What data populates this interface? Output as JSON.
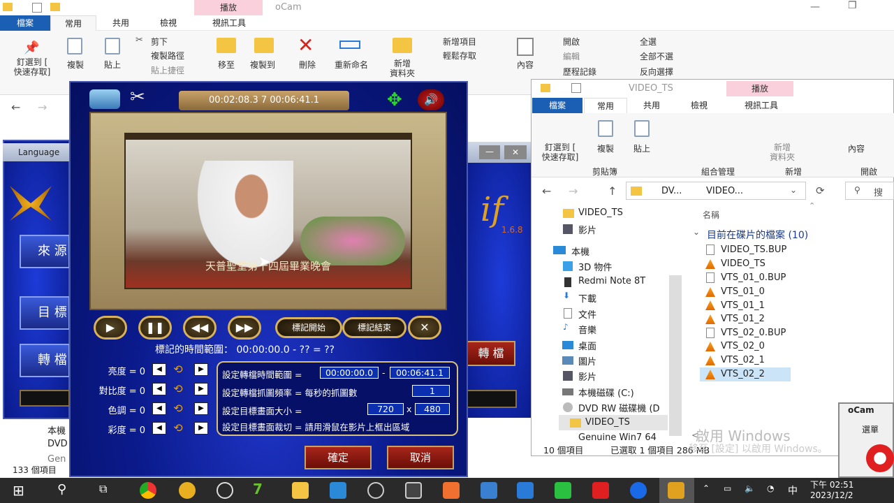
{
  "bg_explorer": {
    "window_title": "oCam",
    "context_tab": "播放",
    "tabs": [
      "檔案",
      "常用",
      "共用",
      "檢視",
      "視訊工具"
    ],
    "ribbon": {
      "pin": "釘選到 [\n快速存取]",
      "copy": "複製",
      "paste": "貼上",
      "cut": "剪下",
      "copy_path": "複製路徑",
      "paste_shortcut": "貼上捷徑",
      "move_to": "移至",
      "copy_to": "複製到",
      "delete": "刪除",
      "rename": "重新命名",
      "new_folder": "新增\n資料夾",
      "new_item": "新增項目",
      "easy_access": "輕鬆存取",
      "properties": "內容",
      "open": "開啟",
      "edit": "編輯",
      "history": "歷程記錄",
      "select_all": "全選",
      "select_none": "全部不選",
      "invert": "反向選擇"
    },
    "left_items": [
      "本機",
      "DVD",
      "Gen"
    ],
    "item_count": "133 個項目"
  },
  "left_app": {
    "language_label": "Language",
    "buttons": [
      "來 源",
      "目 標",
      "轉 檔"
    ],
    "version": "1.6.8",
    "logo_fragment": "if",
    "convert_button": "轉 檔"
  },
  "player": {
    "time_display": "00:02:08.3 7  00:06:41.1",
    "video_caption": "天普聖堂第十四屆畢業晚會",
    "mark_start": "標記開始",
    "mark_end": "標記結束",
    "range_text": "標記的時間範圍：  00:00:00.0 - ?? = ??",
    "adjustments": [
      {
        "label": "亮度 = 0"
      },
      {
        "label": "對比度 = 0"
      },
      {
        "label": "色調 = 0"
      },
      {
        "label": "彩度 = 0"
      }
    ],
    "settings": {
      "range_label": "設定轉檔時間範圍 =",
      "range_start": "00:00:00.0",
      "range_sep": "-",
      "range_end": "00:06:41.1",
      "fps_label": "設定轉檔抓圖頻率 = 每秒的抓圖數",
      "fps_value": "1",
      "size_label": "設定目標畫面大小 =",
      "width": "720",
      "x": "x",
      "height": "480",
      "crop_label": "設定目標畫面裁切 = 請用滑鼠在影片上框出區域"
    },
    "ok": "確定",
    "cancel": "取消"
  },
  "right_explorer": {
    "title_path": "VIDEO_TS",
    "context_tab": "播放",
    "tabs": [
      "檔案",
      "常用",
      "共用",
      "檢視",
      "視訊工具"
    ],
    "ribbon": {
      "pin": "釘選到 [\n快速存取]",
      "copy": "複製",
      "paste": "貼上",
      "new_folder": "新增\n資料夾",
      "properties": "內容",
      "group_clipboard": "剪貼簿",
      "group_organize": "組合管理",
      "group_new": "新增",
      "group_open": "開啟"
    },
    "address": [
      "DV...",
      "VIDEO..."
    ],
    "search_placeholder": "搜",
    "nav": [
      {
        "label": "VIDEO_TS"
      },
      {
        "label": "影片"
      },
      {
        "label": "本機"
      },
      {
        "label": "3D 物件"
      },
      {
        "label": "Redmi Note 8T"
      },
      {
        "label": "下載"
      },
      {
        "label": "文件"
      },
      {
        "label": "音樂"
      },
      {
        "label": "桌面"
      },
      {
        "label": "圖片"
      },
      {
        "label": "影片"
      },
      {
        "label": "本機磁碟 (C:)"
      },
      {
        "label": "DVD RW 磁碟機 (D"
      },
      {
        "label": "VIDEO_TS"
      },
      {
        "label": "Genuine Win7 64"
      }
    ],
    "column_name": "名稱",
    "group_header": "目前在碟片的檔案 (10)",
    "files": [
      {
        "name": "VIDEO_TS.BUP",
        "type": "bup"
      },
      {
        "name": "VIDEO_TS",
        "type": "vlc"
      },
      {
        "name": "VTS_01_0.BUP",
        "type": "bup"
      },
      {
        "name": "VTS_01_0",
        "type": "vlc"
      },
      {
        "name": "VTS_01_1",
        "type": "vlc"
      },
      {
        "name": "VTS_01_2",
        "type": "vlc"
      },
      {
        "name": "VTS_02_0.BUP",
        "type": "bup"
      },
      {
        "name": "VTS_02_0",
        "type": "vlc"
      },
      {
        "name": "VTS_02_1",
        "type": "vlc"
      },
      {
        "name": "VTS_02_2",
        "type": "vlc"
      }
    ],
    "status_items": "10 個項目",
    "status_selected": "已選取 1 個項目 286 MB",
    "watermark1": "啟用 Windows",
    "watermark2": "移至 [設定] 以啟用 Windows。"
  },
  "ocam": {
    "title": "oCam",
    "menu": "選單"
  },
  "taskbar": {
    "time": "下午 02:51",
    "date": "2023/12/2",
    "ime": "中"
  }
}
